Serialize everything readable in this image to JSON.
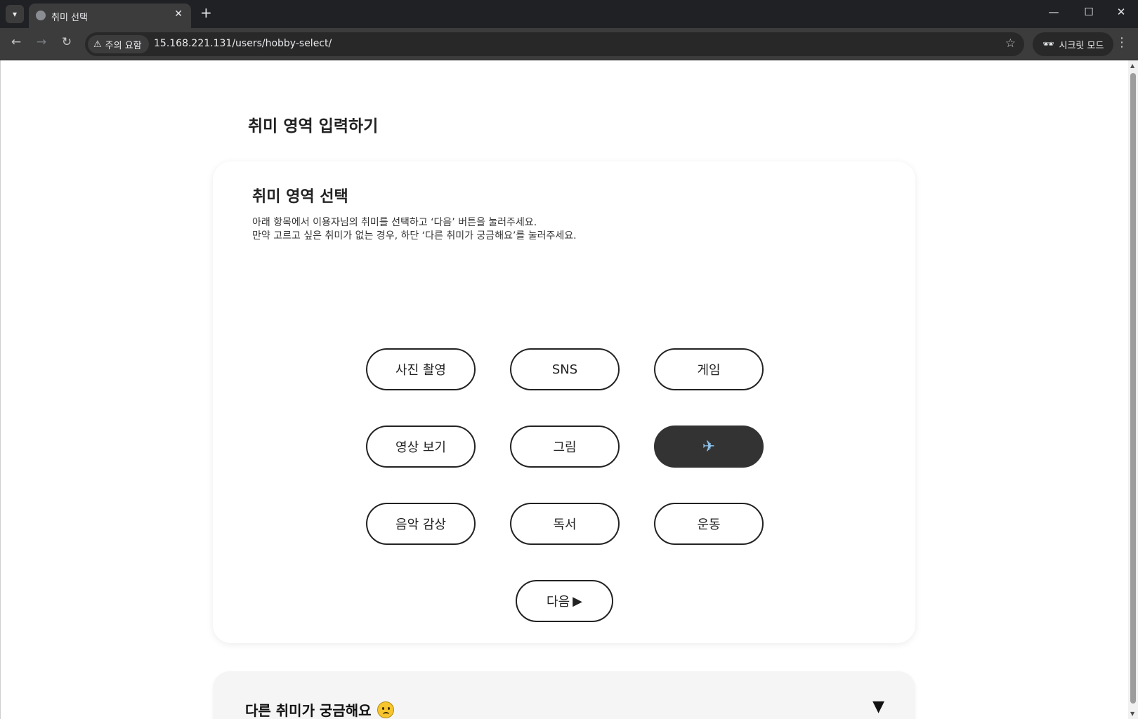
{
  "browser": {
    "tab_title": "취미 선택",
    "tab_close": "✕",
    "new_tab": "+",
    "security_label": "주의 요함",
    "url": "15.168.221.131/users/hobby-select/",
    "incognito_label": "시크릿 모드",
    "icons": {
      "tab_search": "▾",
      "minimize": "—",
      "maximize": "☐",
      "close": "✕",
      "back": "←",
      "forward": "→",
      "reload": "↻",
      "warning": "⚠",
      "star": "☆",
      "incognito": "🕶",
      "menu": "⋮"
    }
  },
  "page": {
    "title": "취미 영역 입력하기"
  },
  "card": {
    "title": "취미 영역 선택",
    "description": [
      "아래 항목에서 이용자님의 취미를 선택하고 ‘다음’ 버튼을 눌러주세요.",
      "만약 고르고 싶은 취미가 없는 경우, 하단 ‘다른 취미가 궁금해요’를 눌러주세요."
    ],
    "hobbies": [
      {
        "label": "사진 촬영",
        "selected": false
      },
      {
        "label": "SNS",
        "selected": false
      },
      {
        "label": "게임",
        "selected": false
      },
      {
        "label": "영상 보기",
        "selected": false
      },
      {
        "label": "그림",
        "selected": false
      },
      {
        "label": "✈",
        "selected": true
      },
      {
        "label": "음악 감상",
        "selected": false
      },
      {
        "label": "독서",
        "selected": false
      },
      {
        "label": "운동",
        "selected": false
      }
    ],
    "next_label": "다음",
    "next_icon": "▶"
  },
  "accordion": {
    "title": "다른 취미가 궁금해요",
    "emoji": "worried-face",
    "toggle_icon": "▼"
  },
  "colors": {
    "selected_button_bg": "#333333",
    "accordion_bg": "#f5f5f5"
  }
}
